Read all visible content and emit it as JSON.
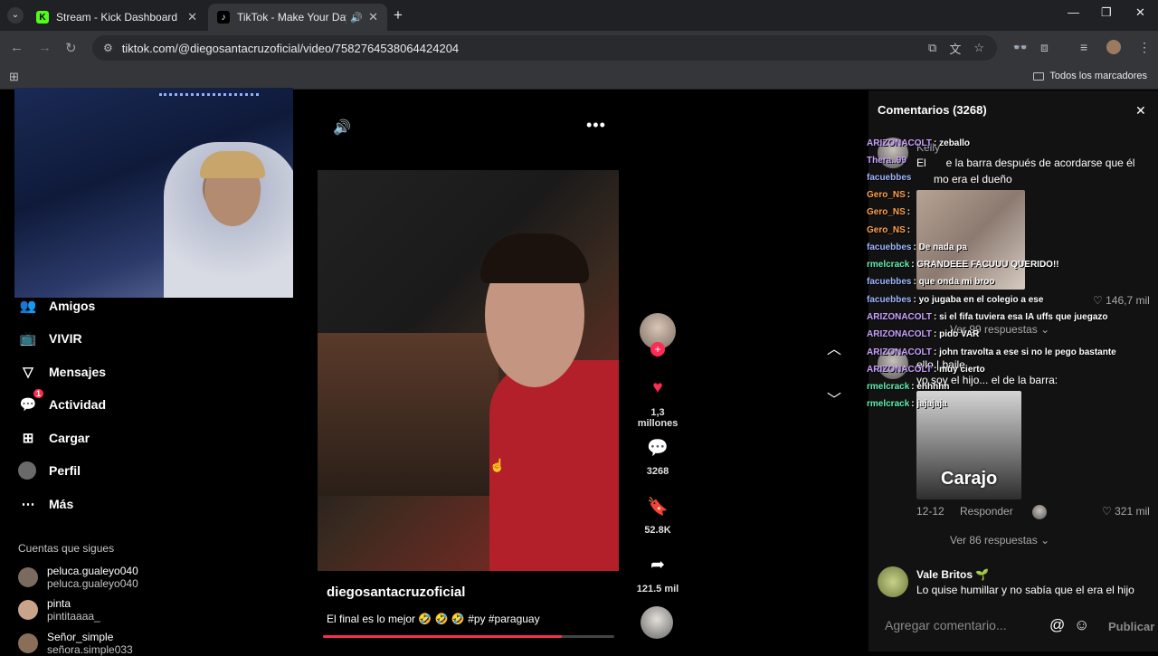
{
  "browser": {
    "tabs": [
      {
        "title": "Stream - Kick Dashboard",
        "favicon": "K"
      },
      {
        "title": "TikTok - Make Your Day",
        "favicon": "♪"
      }
    ],
    "url": "tiktok.com/@diegosantacruzoficial/video/7582764538064424204",
    "bookmarks_label": "Todos los marcadores"
  },
  "sidebar": {
    "items": [
      {
        "label": "Amigos",
        "icon": "friends-icon"
      },
      {
        "label": "VIVIR",
        "icon": "live-icon"
      },
      {
        "label": "Mensajes",
        "icon": "messages-icon"
      },
      {
        "label": "Actividad",
        "icon": "activity-icon",
        "badge": "1"
      },
      {
        "label": "Cargar",
        "icon": "upload-icon"
      },
      {
        "label": "Perfil",
        "icon": "profile-icon"
      },
      {
        "label": "Más",
        "icon": "more-icon"
      }
    ],
    "following_title": "Cuentas que sigues",
    "following": [
      {
        "name": "peluca.gualeyo040",
        "handle": "peluca.gualeyo040"
      },
      {
        "name": "pinta",
        "handle": "pintitaaaa_"
      },
      {
        "name": "Señor_simple",
        "handle": "señora.simple033"
      }
    ]
  },
  "video": {
    "author": "diegosantacruzoficial",
    "caption": "El final es lo mejor 🤣 🤣 🤣 #py #paraguay",
    "progress": 0.82
  },
  "actions": {
    "likes": "1,3 millones",
    "comments": "3268",
    "saves": "52.8K",
    "shares": "121.5 mil"
  },
  "comments_panel": {
    "title": "Comentarios (3268)",
    "c1_user": "Kelly",
    "c1_text_a": "El",
    "c1_text_b": "e la barra después de acordarse que él",
    "c1_text_c": "mo era el dueño",
    "c1_likes": "146,7 mil",
    "c1_replies": "Ver 99 respuestas",
    "c2_text_a": "ello | baile",
    "c2_text_b": "yo soy el hijo... el de la barra:",
    "c2_img_text": "Carajo",
    "c2_date": "12-12",
    "c2_reply": "Responder",
    "c2_likes": "321 mil",
    "c2_replies": "Ver 86 respuestas",
    "c3_user": "Vale Britos",
    "c3_text": "Lo quise humillar y no sabía que el era el hijo",
    "input_placeholder": "Agregar comentario...",
    "publish": "Publicar"
  },
  "chat_overlay": [
    {
      "user": "ARIZONACOLT",
      "color": "#c9a0ff",
      "msg": ": zeballo"
    },
    {
      "user": "Thera..99",
      "color": "#c9a0ff",
      "msg": ""
    },
    {
      "user": "facuebbes",
      "color": "#9fb4ff",
      "msg": ""
    },
    {
      "user": "Gero_NS",
      "color": "#ff9e4a",
      "msg": ":"
    },
    {
      "user": "Gero_NS",
      "color": "#ff9e4a",
      "msg": ":"
    },
    {
      "user": "Gero_NS",
      "color": "#ff9e4a",
      "msg": ":"
    },
    {
      "user": "facuebbes",
      "color": "#9fb4ff",
      "msg": ": De nada pa"
    },
    {
      "user": "rmelcrack",
      "color": "#5ef0b0",
      "msg": ": GRANDEEE FACUUU QUERIDO!!"
    },
    {
      "user": "facuebbes",
      "color": "#9fb4ff",
      "msg": ": que onda mi broo"
    },
    {
      "user": "facuebbes",
      "color": "#9fb4ff",
      "msg": ": yo jugaba en el colegio a ese"
    },
    {
      "user": "ARIZONACOLT",
      "color": "#c9a0ff",
      "msg": ": si el fifa tuviera esa IA uffs que juegazo"
    },
    {
      "user": "ARIZONACOLT",
      "color": "#c9a0ff",
      "msg": ": pido VAR"
    },
    {
      "user": "ARIZONACOLT",
      "color": "#c9a0ff",
      "msg": ": john travolta a ese si no le pego bastante"
    },
    {
      "user": "ARIZONACOLT",
      "color": "#c9a0ff",
      "msg": ": muy cierto"
    },
    {
      "user": "rmelcrack",
      "color": "#5ef0b0",
      "msg": ": ehhhhh"
    },
    {
      "user": "rmelcrack",
      "color": "#5ef0b0",
      "msg": ": jajajaja"
    }
  ]
}
